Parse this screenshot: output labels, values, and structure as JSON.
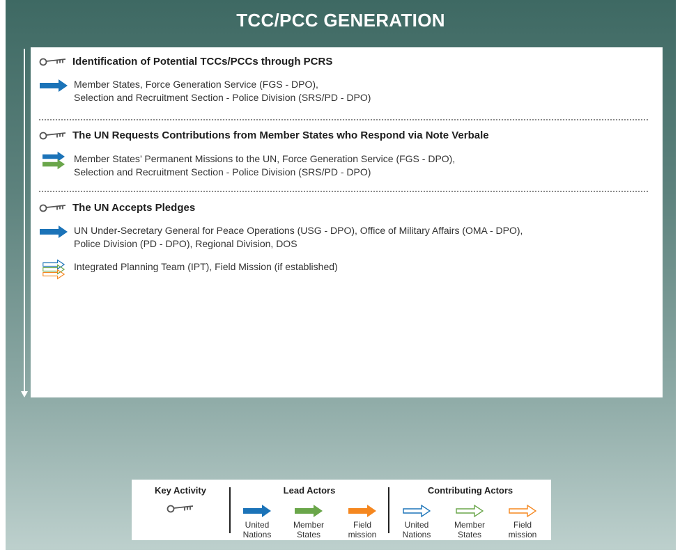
{
  "title": "TCC/PCC GENERATION",
  "colors": {
    "united_nations": "#1b73b8",
    "member_states": "#6aa64a",
    "field_mission": "#f5871f",
    "key": "#555555"
  },
  "sections": [
    {
      "heading": "Identification of Potential TCCs/PCCs through PCRS",
      "actors": [
        {
          "arrow": "united-nations-lead-arrow",
          "lines": [
            "Member States, Force Generation Service (FGS - DPO),",
            "Selection and Recruitment Section - Police Division (SRS/PD - DPO)"
          ]
        }
      ]
    },
    {
      "heading": "The UN Requests Contributions from Member States who Respond via Note Verbale",
      "actors": [
        {
          "arrow": "member-states-and-united-nations-lead-arrow",
          "lines": [
            "Member States’ Permanent Missions to the UN, Force Generation Service (FGS - DPO),",
            "Selection and Recruitment Section - Police Division (SRS/PD - DPO)"
          ]
        }
      ]
    },
    {
      "heading": "The UN Accepts Pledges",
      "actors": [
        {
          "arrow": "united-nations-lead-arrow",
          "lines": [
            "UN Under-Secretary General for Peace Operations (USG - DPO), Office of Military Affairs (OMA - DPO),",
            "Police Division (PD - DPO), Regional Division, DOS"
          ]
        },
        {
          "arrow": "contributing-actors-outline-arrow",
          "lines": [
            "Integrated Planning Team (IPT), Field Mission (if established)"
          ]
        }
      ]
    }
  ],
  "legend": {
    "key_activity": "Key Activity",
    "lead_actors": "Lead Actors",
    "contributing_actors": "Contributing Actors",
    "lead_items": [
      {
        "line1": "United",
        "line2": "Nations"
      },
      {
        "line1": "Member",
        "line2": "States"
      },
      {
        "line1": "Field",
        "line2": "mission"
      }
    ],
    "contrib_items": [
      {
        "line1": "United",
        "line2": "Nations"
      },
      {
        "line1": "Member",
        "line2": "States"
      },
      {
        "line1": "Field",
        "line2": "mission"
      }
    ]
  }
}
